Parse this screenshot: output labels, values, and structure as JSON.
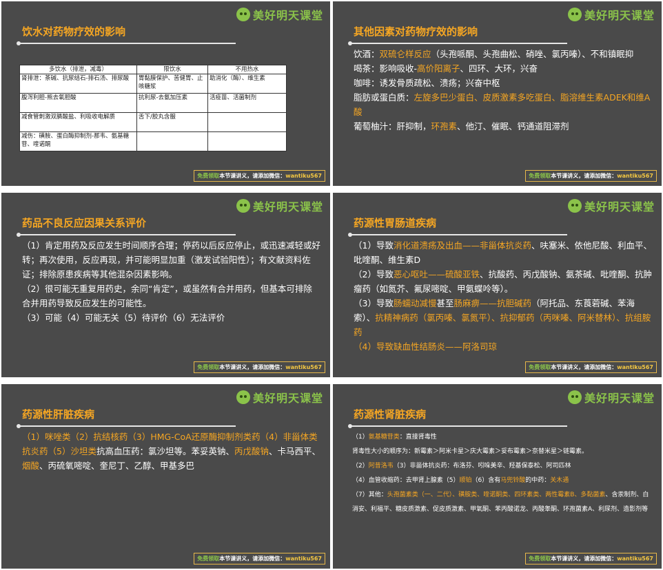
{
  "brand": "美好明天课堂",
  "footer": {
    "free": "免费领取",
    "text": "本节课讲义，请添加微信：",
    "wechat": "wantiku567"
  },
  "slide1": {
    "title": "饮水对药物疗效的影响",
    "headers": [
      "多饮水（排泄，减毒）",
      "限饮水",
      "不用热水"
    ],
    "rows": [
      [
        "肾排泄：茶碱、抗尿结石-排石汤、排尿酸",
        "胃黏膜保护、苦健胃、止咳糖浆",
        "助消化（酶）、维生素"
      ],
      [
        "腹泻利胆-熊去氧胆酸",
        "抗利尿-去氨加压素",
        "活疫苗、活菌制剂"
      ],
      [
        "减食管刺激双膦酸盐、利吸收电解质",
        "舌下/胶丸含服",
        ""
      ],
      [
        "减伤：磺胺、蛋白酶抑制剂-那韦、氨基糖苷、喹诺酮",
        "",
        ""
      ]
    ]
  },
  "slide2": {
    "title": "其他因素对药物疗效的影响",
    "l1a": "饮酒：",
    "l1b": "双硫仑样反应",
    "l1c": "（头孢哌酮、头孢曲松、硝唑、氯丙嗪）、不和镇眠抑",
    "l2a": "喝茶：影响吸收-",
    "l2b": "高价阳离子",
    "l2c": "、四环、大环，兴奋",
    "l3": "咖啡：诱发骨质疏松、溃疡；兴奋中枢",
    "l4a": "脂肪或蛋白质：",
    "l4b": "左旋多巴少蛋白、皮质激素多吃蛋白、脂溶维生素ADEK和维A酸",
    "l5a": "葡萄柚汁：肝抑制，",
    "l5b": "环孢素",
    "l5c": "、他汀、催眠、钙通道阻滞剂"
  },
  "slide3": {
    "title": "药品不良反应因果关系评价",
    "p1": "（1）肯定用药及反应发生时间顺序合理；停药以后反应停止，或迅速减轻或好转；再次使用，反应再现，并可能明显加重（激发试验阳性）；有文献资料佐证；排除原患疾病等其他混杂因素影响。",
    "p2": "（2）很可能无重复用药史，余同“肯定”，或虽然有合并用药，但基本可排除合并用药导致反应发生的可能性。",
    "p3": "（3）可能（4）可能无关（5）待评价（6）无法评价"
  },
  "slide4": {
    "title": "药源性胃肠道疾病",
    "a1": "（1）导致",
    "a2": "消化道溃疡及出血——非甾体抗炎药",
    "a3": "、呋塞米、依他尼酸、利血平、吡喹酮、维生素D",
    "b1": "（2）导致",
    "b2": "恶心呕吐——硫酸亚铁",
    "b3": "、抗酸药、丙戊酸钠、氨茶碱、吡喹酮、抗肿瘤药（如氮芥、氟尿嘧啶、甲氨蝶呤等）。",
    "c1": "（3）导致",
    "c2": "肠蠕动减慢",
    "c3": "甚至",
    "c4": "肠麻痹——抗胆碱药",
    "c5": "（阿托品、东莨菪碱、苯海索）、",
    "c6": "抗精神病药（氯丙嗪、氯氮平）、抗抑郁药（丙咪嗪、阿米替林）、抗组胺药",
    "d1": "（4）导致缺血性结肠炎——阿洛司琼"
  },
  "slide5": {
    "title": "药源性肝脏疾病",
    "a": "（1）咪唑类（2）抗结核药（3）HMG-CoA还原酶抑制剂类药（4）非甾体类抗炎药（5）沙坦类",
    "b": "抗高血压药：氯沙坦等。苯妥英钠、",
    "c": "丙戊酸钠",
    "d": "、卡马西平、",
    "e": "烟酸",
    "f": "、丙硫氧嘧啶、奎尼丁、乙醇、甲基多巴"
  },
  "slide6": {
    "title": "药源性肾脏疾病",
    "l1a": "（1）",
    "l1b": "氨基糖苷类",
    "l1c": "：直接肾毒性",
    "l2": "肾毒性大小的顺序为：新霉素＞阿米卡星＞庆大霉素＞妥布霉素＞奈替米星＞链霉素。",
    "l3a": "（2）",
    "l3b": "阿昔洛韦",
    "l3c": "（3）非甾体抗炎药：布洛芬、吲哚美辛、羟基保泰松、阿司匹林",
    "l4a": "（4）血管收缩药：去甲肾上腺素（5）",
    "l4b": "顺铂",
    "l4c": "（6）含有",
    "l4d": "马兜铃酸",
    "l4e": "的中药：",
    "l4f": "关木通",
    "l5a": "（7）其他：",
    "l5b": "头孢菌素类（一、二代）、磺胺类、喹诺酮类、四环素类、两性霉素B、多黏菌素",
    "l5c": "、含汞制剂、白消安、利福平、糖皮质激素、促皮质激素、甲氧酮、苯丙酸诺龙、丙酸睾酮、环孢菌素A、利尿剂、造影剂等"
  }
}
